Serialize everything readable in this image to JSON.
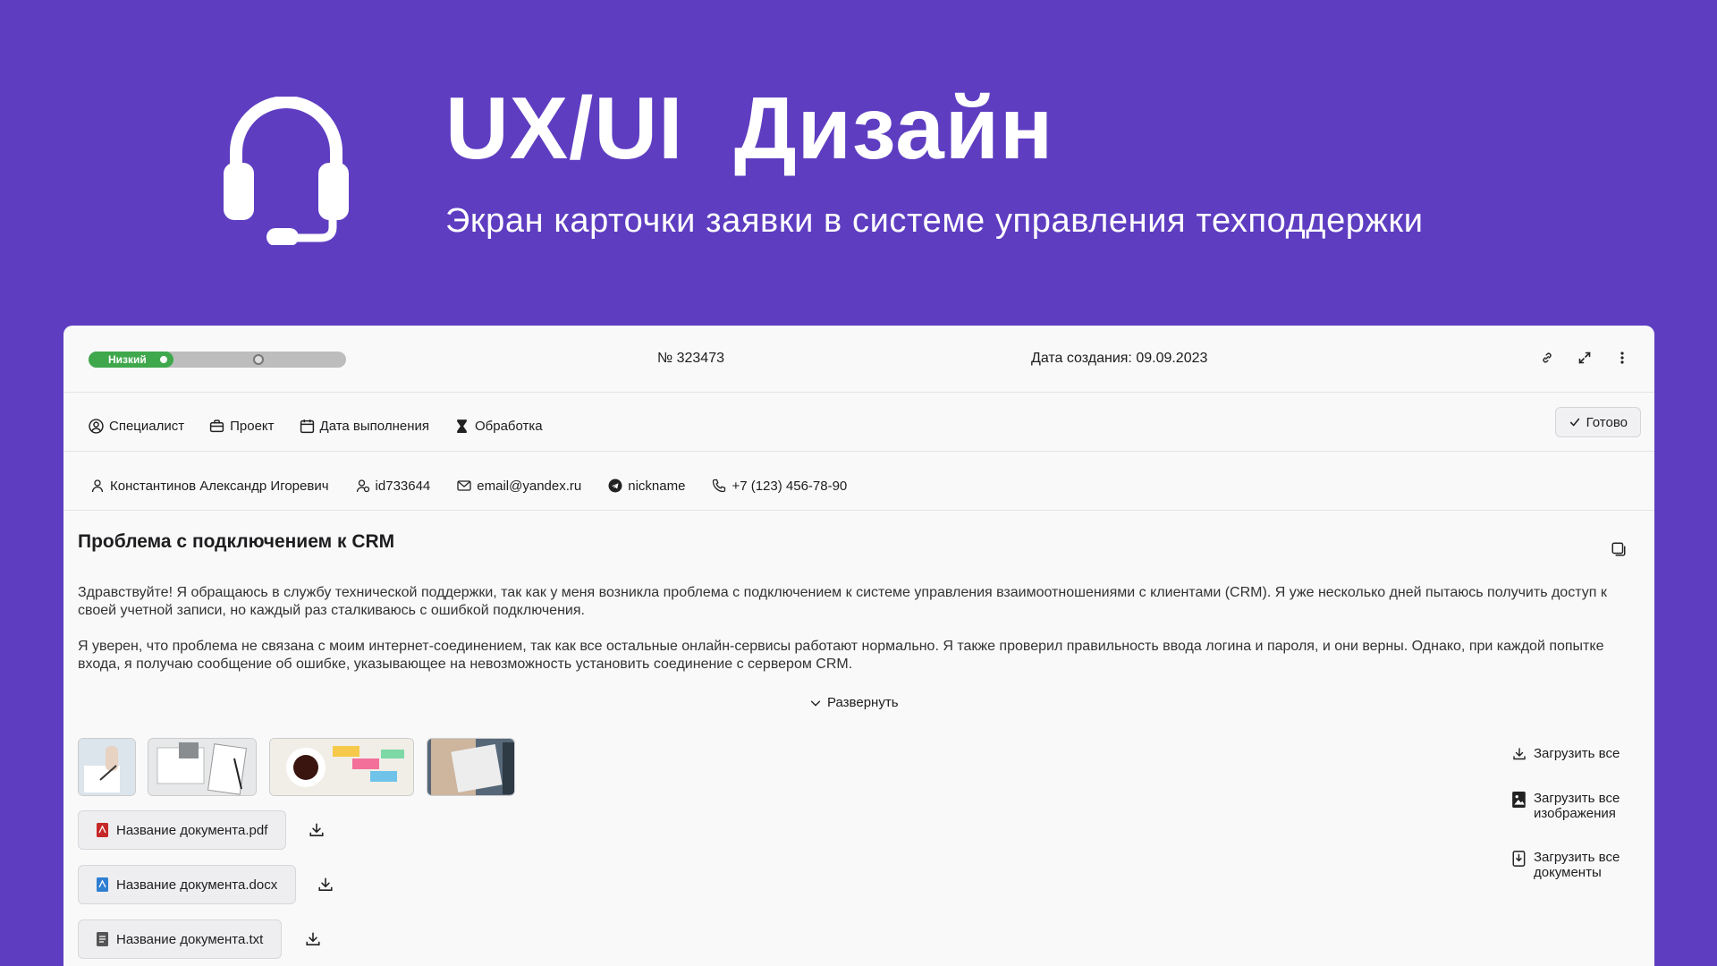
{
  "hero": {
    "title": "UX/UI  Дизайн",
    "subtitle": "Экран карточки заявки в системе управления техподдержки",
    "icon": "headset-icon"
  },
  "ticket": {
    "priority_label": "Низкий",
    "priority_level": 0.33,
    "number": "№ 323473",
    "created": "Дата создания: 09.09.2023"
  },
  "toolbar": {
    "specialist": "Специалист",
    "project": "Проект",
    "due_date": "Дата выполнения",
    "processing": "Обработка",
    "done": "Готово"
  },
  "contact": {
    "name": "Константинов Александр Игоревич",
    "id": "id733644",
    "email": "email@yandex.ru",
    "telegram": "nickname",
    "phone": "+7 (123) 456-78-90"
  },
  "issue": {
    "title": "Проблема с подключением к CRM",
    "paragraph1": "Здравствуйте! Я обращаюсь в службу технической поддержки, так как у меня возникла проблема с подключением к системе управления взаимоотношениями с клиентами (CRM). Я уже несколько дней пытаюсь получить доступ к своей учетной записи, но каждый раз сталкиваюсь с ошибкой подключения.",
    "paragraph2": "Я уверен, что проблема не связана с моим интернет-соединением, так как все остальные онлайн-сервисы работают нормально. Я также проверил правильность ввода логина и пароля, и они верны. Однако, при каждой попытке входа, я получаю сообщение об ошибке, указывающее на невозможность установить соединение с сервером CRM.",
    "expand": "Развернуть"
  },
  "documents": [
    {
      "name": "Название документа.pdf",
      "color": "#C62828"
    },
    {
      "name": "Название документа.docx",
      "color": "#2F7FD1"
    },
    {
      "name": "Название документа.txt",
      "color": "#555555"
    }
  ],
  "actions": {
    "download_all": "Загрузить все",
    "download_images_1": "Загрузить все",
    "download_images_2": "изображения",
    "download_docs_1": "Загрузить все",
    "download_docs_2": "документы"
  },
  "colors": {
    "background": "#5E3DC1",
    "card": "#F9F9FA",
    "priority_green": "#3FA84C"
  }
}
